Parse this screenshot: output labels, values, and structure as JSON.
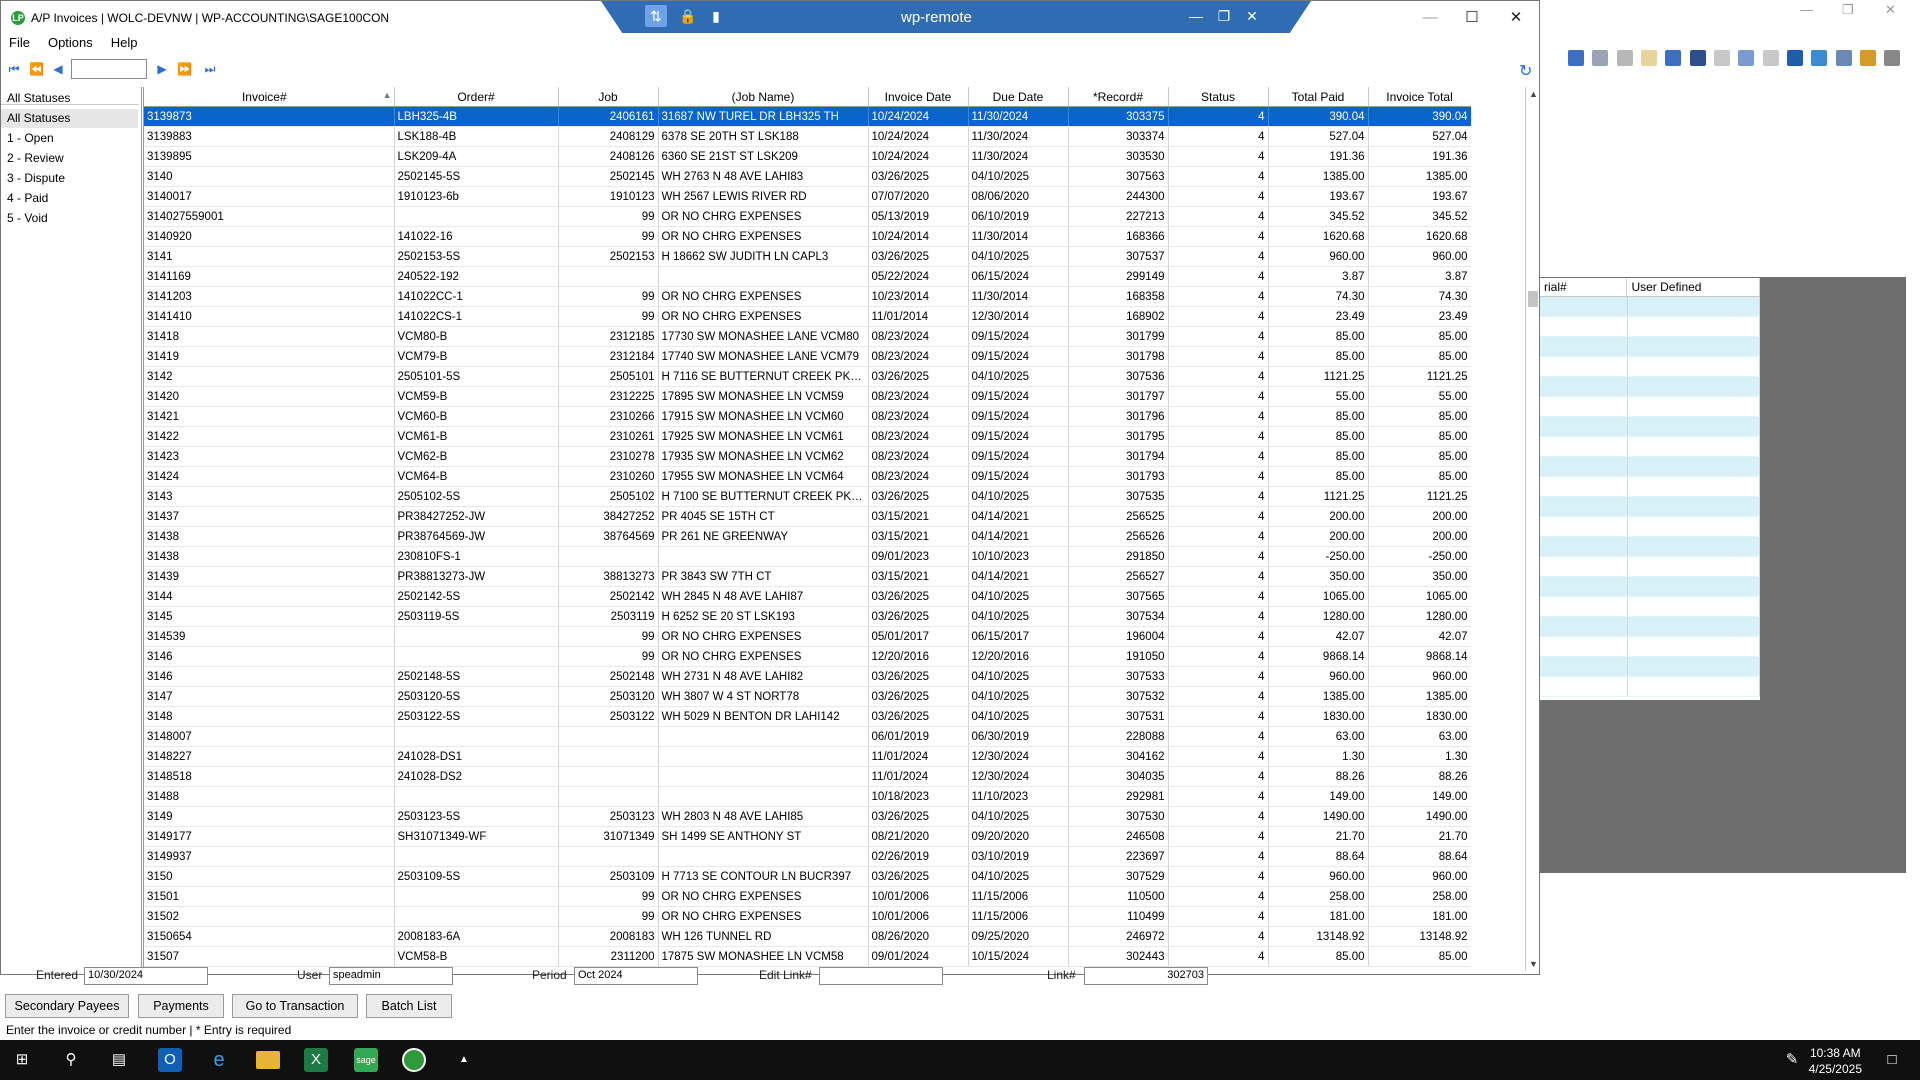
{
  "window": {
    "title": "A/P Invoices  |  WOLC-DEVNW  |  WP-ACCOUNTING\\SAGE100CON",
    "app_icon_letter": "LP",
    "controls": [
      "minimize",
      "maximize",
      "close"
    ]
  },
  "remote_bar": {
    "title": "wp-remote"
  },
  "menu": [
    "File",
    "Options",
    "Help"
  ],
  "statuses": {
    "header": "All Statuses",
    "items": [
      "All Statuses",
      "1 - Open",
      "2 - Review",
      "3 - Dispute",
      "4 - Paid",
      "5 - Void"
    ],
    "selected": "All Statuses"
  },
  "grid": {
    "columns": [
      "Invoice#",
      "Order#",
      "Job",
      "(Job Name)",
      "Invoice Date",
      "Due Date",
      "*Record#",
      "Status",
      "Total Paid",
      "Invoice Total"
    ],
    "rows": [
      [
        "3139873",
        "LBH325-4B",
        "2406161",
        "31687 NW TUREL DR  LBH325 TH",
        "10/24/2024",
        "11/30/2024",
        "303375",
        "4",
        "390.04",
        "390.04"
      ],
      [
        "3139883",
        "LSK188-4B",
        "2408129",
        "6378 SE 20TH ST LSK188",
        "10/24/2024",
        "11/30/2024",
        "303374",
        "4",
        "527.04",
        "527.04"
      ],
      [
        "3139895",
        "LSK209-4A",
        "2408126",
        "6360 SE 21ST ST LSK209",
        "10/24/2024",
        "11/30/2024",
        "303530",
        "4",
        "191.36",
        "191.36"
      ],
      [
        "3140",
        "2502145-5S",
        "2502145",
        "WH 2763 N 48 AVE LAHI83",
        "03/26/2025",
        "04/10/2025",
        "307563",
        "4",
        "1385.00",
        "1385.00"
      ],
      [
        "3140017",
        "1910123-6b",
        "1910123",
        "WH 2567 LEWIS RIVER RD",
        "07/07/2020",
        "08/06/2020",
        "244300",
        "4",
        "193.67",
        "193.67"
      ],
      [
        "314027559001",
        "",
        "99",
        "OR NO CHRG  EXPENSES",
        "05/13/2019",
        "06/10/2019",
        "227213",
        "4",
        "345.52",
        "345.52"
      ],
      [
        "3140920",
        "141022-16",
        "99",
        "OR NO CHRG  EXPENSES",
        "10/24/2014",
        "11/30/2014",
        "168366",
        "4",
        "1620.68",
        "1620.68"
      ],
      [
        "3141",
        "2502153-5S",
        "2502153",
        "H 18662 SW JUDITH LN CAPL3",
        "03/26/2025",
        "04/10/2025",
        "307537",
        "4",
        "960.00",
        "960.00"
      ],
      [
        "3141169",
        "240522-192",
        "",
        "",
        "05/22/2024",
        "06/15/2024",
        "299149",
        "4",
        "3.87",
        "3.87"
      ],
      [
        "3141203",
        "141022CC-1",
        "99",
        "OR NO CHRG  EXPENSES",
        "10/23/2014",
        "11/30/2014",
        "168358",
        "4",
        "74.30",
        "74.30"
      ],
      [
        "3141410",
        "141022CS-1",
        "99",
        "OR NO CHRG  EXPENSES",
        "11/01/2014",
        "12/30/2014",
        "168902",
        "4",
        "23.49",
        "23.49"
      ],
      [
        "31418",
        "VCM80-B",
        "2312185",
        "17730 SW MONASHEE LANE VCM80",
        "08/23/2024",
        "09/15/2024",
        "301799",
        "4",
        "85.00",
        "85.00"
      ],
      [
        "31419",
        "VCM79-B",
        "2312184",
        "17740 SW MONASHEE LANE VCM79",
        "08/23/2024",
        "09/15/2024",
        "301798",
        "4",
        "85.00",
        "85.00"
      ],
      [
        "3142",
        "2505101-5S",
        "2505101",
        "H 7116 SE BUTTERNUT CREEK PKWY...",
        "03/26/2025",
        "04/10/2025",
        "307536",
        "4",
        "1121.25",
        "1121.25"
      ],
      [
        "31420",
        "VCM59-B",
        "2312225",
        "17895 SW MONASHEE LN VCM59",
        "08/23/2024",
        "09/15/2024",
        "301797",
        "4",
        "55.00",
        "55.00"
      ],
      [
        "31421",
        "VCM60-B",
        "2310266",
        "17915 SW MONASHEE LN VCM60",
        "08/23/2024",
        "09/15/2024",
        "301796",
        "4",
        "85.00",
        "85.00"
      ],
      [
        "31422",
        "VCM61-B",
        "2310261",
        "17925 SW MONASHEE LN VCM61",
        "08/23/2024",
        "09/15/2024",
        "301795",
        "4",
        "85.00",
        "85.00"
      ],
      [
        "31423",
        "VCM62-B",
        "2310278",
        "17935 SW MONASHEE LN VCM62",
        "08/23/2024",
        "09/15/2024",
        "301794",
        "4",
        "85.00",
        "85.00"
      ],
      [
        "31424",
        "VCM64-B",
        "2310260",
        "17955 SW MONASHEE LN VCM64",
        "08/23/2024",
        "09/15/2024",
        "301793",
        "4",
        "85.00",
        "85.00"
      ],
      [
        "3143",
        "2505102-5S",
        "2505102",
        "H 7100 SE BUTTERNUT CREEK PKWY...",
        "03/26/2025",
        "04/10/2025",
        "307535",
        "4",
        "1121.25",
        "1121.25"
      ],
      [
        "31437",
        "PR38427252-JW",
        "38427252",
        "PR 4045 SE 15TH CT",
        "03/15/2021",
        "04/14/2021",
        "256525",
        "4",
        "200.00",
        "200.00"
      ],
      [
        "31438",
        "PR38764569-JW",
        "38764569",
        "PR 261 NE GREENWAY",
        "03/15/2021",
        "04/14/2021",
        "256526",
        "4",
        "200.00",
        "200.00"
      ],
      [
        "31438",
        "230810FS-1",
        "",
        "",
        "09/01/2023",
        "10/10/2023",
        "291850",
        "4",
        "-250.00",
        "-250.00"
      ],
      [
        "31439",
        "PR38813273-JW",
        "38813273",
        "PR 3843 SW 7TH CT",
        "03/15/2021",
        "04/14/2021",
        "256527",
        "4",
        "350.00",
        "350.00"
      ],
      [
        "3144",
        "2502142-5S",
        "2502142",
        "WH 2845 N 48 AVE LAHI87",
        "03/26/2025",
        "04/10/2025",
        "307565",
        "4",
        "1065.00",
        "1065.00"
      ],
      [
        "3145",
        "2503119-5S",
        "2503119",
        "H 6252 SE 20 ST LSK193",
        "03/26/2025",
        "04/10/2025",
        "307534",
        "4",
        "1280.00",
        "1280.00"
      ],
      [
        "314539",
        "",
        "99",
        "OR NO CHRG  EXPENSES",
        "05/01/2017",
        "06/15/2017",
        "196004",
        "4",
        "42.07",
        "42.07"
      ],
      [
        "3146",
        "",
        "99",
        "OR NO CHRG  EXPENSES",
        "12/20/2016",
        "12/20/2016",
        "191050",
        "4",
        "9868.14",
        "9868.14"
      ],
      [
        "3146",
        "2502148-5S",
        "2502148",
        "WH 2731 N 48 AVE LAHI82",
        "03/26/2025",
        "04/10/2025",
        "307533",
        "4",
        "960.00",
        "960.00"
      ],
      [
        "3147",
        "2503120-5S",
        "2503120",
        "WH 3807 W 4 ST NORT78",
        "03/26/2025",
        "04/10/2025",
        "307532",
        "4",
        "1385.00",
        "1385.00"
      ],
      [
        "3148",
        "2503122-5S",
        "2503122",
        "WH 5029 N BENTON DR LAHI142",
        "03/26/2025",
        "04/10/2025",
        "307531",
        "4",
        "1830.00",
        "1830.00"
      ],
      [
        "3148007",
        "",
        "",
        "",
        "06/01/2019",
        "06/30/2019",
        "228088",
        "4",
        "63.00",
        "63.00"
      ],
      [
        "3148227",
        "241028-DS1",
        "",
        "",
        "11/01/2024",
        "12/30/2024",
        "304162",
        "4",
        "1.30",
        "1.30"
      ],
      [
        "3148518",
        "241028-DS2",
        "",
        "",
        "11/01/2024",
        "12/30/2024",
        "304035",
        "4",
        "88.26",
        "88.26"
      ],
      [
        "31488",
        "",
        "",
        "",
        "10/18/2023",
        "11/10/2023",
        "292981",
        "4",
        "149.00",
        "149.00"
      ],
      [
        "3149",
        "2503123-5S",
        "2503123",
        "WH 2803 N 48 AVE LAHI85",
        "03/26/2025",
        "04/10/2025",
        "307530",
        "4",
        "1490.00",
        "1490.00"
      ],
      [
        "3149177",
        "SH31071349-WF",
        "31071349",
        "SH 1499 SE ANTHONY ST",
        "08/21/2020",
        "09/20/2020",
        "246508",
        "4",
        "21.70",
        "21.70"
      ],
      [
        "3149937",
        "",
        "",
        "",
        "02/26/2019",
        "03/10/2019",
        "223697",
        "4",
        "88.64",
        "88.64"
      ],
      [
        "3150",
        "2503109-5S",
        "2503109",
        "H 7713 SE CONTOUR LN BUCR397",
        "03/26/2025",
        "04/10/2025",
        "307529",
        "4",
        "960.00",
        "960.00"
      ],
      [
        "31501",
        "",
        "99",
        "OR NO CHRG  EXPENSES",
        "10/01/2006",
        "11/15/2006",
        "110500",
        "4",
        "258.00",
        "258.00"
      ],
      [
        "31502",
        "",
        "99",
        "OR NO CHRG  EXPENSES",
        "10/01/2006",
        "11/15/2006",
        "110499",
        "4",
        "181.00",
        "181.00"
      ],
      [
        "3150654",
        "2008183-6A",
        "2008183",
        "WH 126 TUNNEL RD",
        "08/26/2020",
        "09/25/2020",
        "246972",
        "4",
        "13148.92",
        "13148.92"
      ],
      [
        "31507",
        "VCM58-B",
        "2311200",
        "17875 SW MONASHEE LN VCM58",
        "09/01/2024",
        "10/15/2024",
        "302443",
        "4",
        "85.00",
        "85.00"
      ]
    ],
    "selected_row": 0
  },
  "background_app": {
    "grid_headers": [
      "rial#",
      "User Defined"
    ]
  },
  "bottom_fields": {
    "entered_label": "Entered",
    "entered_value": "10/30/2024",
    "user_label": "User",
    "user_value": "speadmin",
    "period_label": "Period",
    "period_value": "Oct 2024",
    "edit_link_label": "Edit Link#",
    "link_label": "Link#",
    "link_value": "302703"
  },
  "buttons": {
    "secondary_payees": "Secondary Payees",
    "payments": "Payments",
    "go_to_transaction": "Go to Transaction",
    "batch_list": "Batch List"
  },
  "status_line": "Enter the invoice or credit number   |   * Entry is required",
  "taskbar": {
    "time": "10:38 AM",
    "date": "4/25/2025"
  },
  "colors": {
    "selection": "#0a64cc",
    "remote_bar": "#2f6cb2",
    "taskbar": "#101010"
  }
}
